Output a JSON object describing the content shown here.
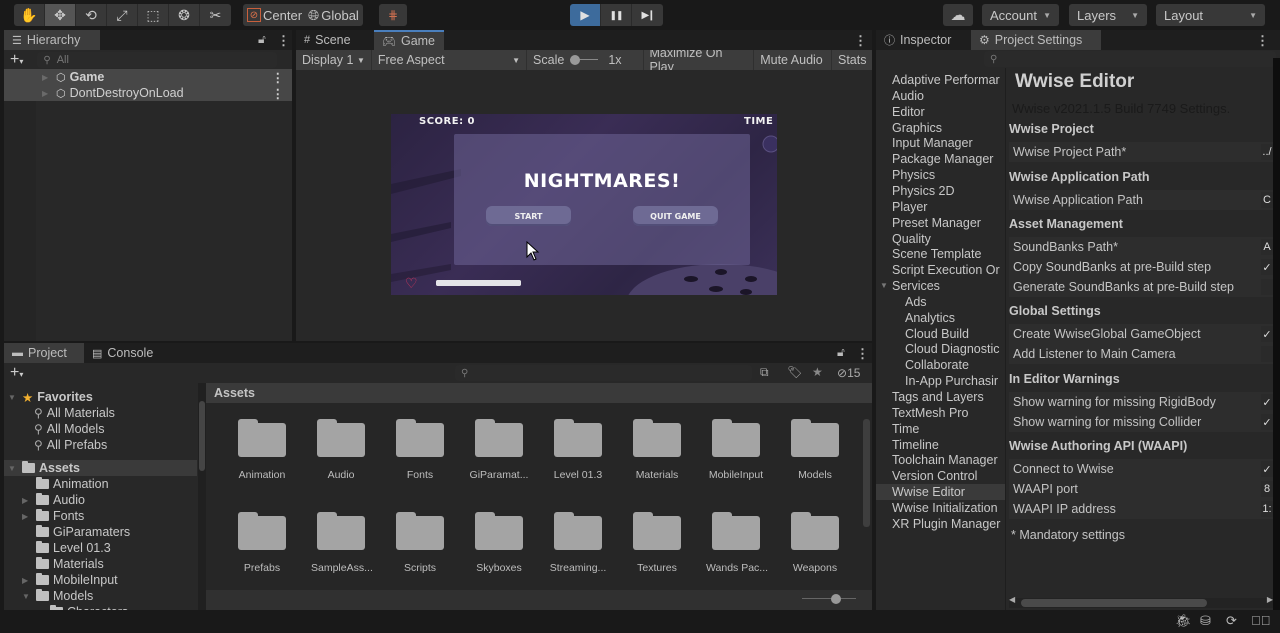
{
  "toolbar": {
    "tools": [
      {
        "name": "hand-tool",
        "glyph": "✋",
        "active": false
      },
      {
        "name": "move-tool",
        "glyph": "✥",
        "active": true
      },
      {
        "name": "rotate-tool",
        "glyph": "⟲",
        "active": false
      },
      {
        "name": "scale-tool",
        "glyph": "⤢",
        "active": false
      },
      {
        "name": "rect-tool",
        "glyph": "⬚",
        "active": false
      },
      {
        "name": "transform-tool",
        "glyph": "❂",
        "active": false
      },
      {
        "name": "custom-tool",
        "glyph": "✂",
        "active": false
      }
    ],
    "pivot_label": "Center",
    "rotation_label": "Global",
    "grid_snap_icon": "grid-snap-icon",
    "play_controls": {
      "play": "▶",
      "pause": "❚❚",
      "step": "▶❙"
    },
    "cloud_icon": "☁",
    "account_label": "Account",
    "layers_label": "Layers",
    "layout_label": "Layout"
  },
  "hierarchy": {
    "tab_label": "Hierarchy",
    "search_placeholder": "All",
    "items": [
      "Game",
      "DontDestroyOnLoad"
    ]
  },
  "game_view": {
    "tabs": [
      "Scene",
      "Game"
    ],
    "display": "Display 1",
    "aspect": "Free Aspect",
    "scale_label": "Scale",
    "scale_value": "1x",
    "maximize_label": "Maximize On Play",
    "mute_label": "Mute Audio",
    "stats_label": "Stats",
    "game": {
      "score": "SCORE: 0",
      "time": "TIME",
      "title": "NIGHTMARES!",
      "start_label": "START",
      "quit_label": "QUIT GAME",
      "health_fraction": 1.0
    }
  },
  "project": {
    "tabs": [
      "Project",
      "Console"
    ],
    "hidden_count": "15",
    "favorites_label": "Favorites",
    "favorites": [
      "All Materials",
      "All Models",
      "All Prefabs"
    ],
    "assets_label": "Assets",
    "tree": [
      {
        "label": "Animation",
        "expandable": false
      },
      {
        "label": "Audio",
        "expandable": true
      },
      {
        "label": "Fonts",
        "expandable": true
      },
      {
        "label": "GiParamaters",
        "expandable": false
      },
      {
        "label": "Level 01.3",
        "expandable": false
      },
      {
        "label": "Materials",
        "expandable": false
      },
      {
        "label": "MobileInput",
        "expandable": true
      },
      {
        "label": "Models",
        "expandable": true,
        "expanded": true
      },
      {
        "label": "Characters",
        "expandable": false
      }
    ],
    "breadcrumb": "Assets",
    "folders": [
      "Animation",
      "Audio",
      "Fonts",
      "GiParamat...",
      "Level 01.3",
      "Materials",
      "MobileInput",
      "Models",
      "Prefabs",
      "SampleAss...",
      "Scripts",
      "Skyboxes",
      "Streaming...",
      "Textures",
      "Wands Pac...",
      "Weapons"
    ]
  },
  "inspector": {
    "tabs": [
      "Inspector",
      "Project Settings"
    ],
    "categories": [
      {
        "label": "Adaptive Performar",
        "indent": 0
      },
      {
        "label": "Audio",
        "indent": 0
      },
      {
        "label": "Editor",
        "indent": 0
      },
      {
        "label": "Graphics",
        "indent": 0
      },
      {
        "label": "Input Manager",
        "indent": 0
      },
      {
        "label": "Package Manager",
        "indent": 0
      },
      {
        "label": "Physics",
        "indent": 0
      },
      {
        "label": "Physics 2D",
        "indent": 0
      },
      {
        "label": "Player",
        "indent": 0
      },
      {
        "label": "Preset Manager",
        "indent": 0
      },
      {
        "label": "Quality",
        "indent": 0
      },
      {
        "label": "Scene Template",
        "indent": 0
      },
      {
        "label": "Script Execution Or",
        "indent": 0
      },
      {
        "label": "Services",
        "indent": 0,
        "expanded": true
      },
      {
        "label": "Ads",
        "indent": 1
      },
      {
        "label": "Analytics",
        "indent": 1
      },
      {
        "label": "Cloud Build",
        "indent": 1
      },
      {
        "label": "Cloud Diagnostic",
        "indent": 1
      },
      {
        "label": "Collaborate",
        "indent": 1
      },
      {
        "label": "In-App Purchasir",
        "indent": 1
      },
      {
        "label": "Tags and Layers",
        "indent": 0
      },
      {
        "label": "TextMesh Pro",
        "indent": 0
      },
      {
        "label": "Time",
        "indent": 0
      },
      {
        "label": "Timeline",
        "indent": 0
      },
      {
        "label": "Toolchain Manager",
        "indent": 0
      },
      {
        "label": "Version Control",
        "indent": 0
      },
      {
        "label": "Wwise Editor",
        "indent": 0,
        "selected": true
      },
      {
        "label": "Wwise Initialization",
        "indent": 0
      },
      {
        "label": "XR Plugin Manager",
        "indent": 0
      }
    ],
    "settings": {
      "title": "Wwise Editor",
      "subtitle": "Wwise v2021.1.5 Build 7749 Settings.",
      "sections": [
        {
          "header": "Wwise Project",
          "rows": [
            {
              "label": "Wwise Project Path*",
              "value": "../"
            }
          ]
        },
        {
          "header": "Wwise Application Path",
          "rows": [
            {
              "label": "Wwise Application Path",
              "value": "C"
            }
          ]
        },
        {
          "header": "Asset Management",
          "rows": [
            {
              "label": "SoundBanks Path*",
              "value": "A"
            },
            {
              "label": "Copy SoundBanks at pre-Build step",
              "value": "✓"
            },
            {
              "label": "Generate SoundBanks at pre-Build step",
              "value": ""
            }
          ]
        },
        {
          "header": "Global Settings",
          "rows": [
            {
              "label": "Create WwiseGlobal GameObject",
              "value": "✓"
            },
            {
              "label": "Add Listener to Main Camera",
              "value": ""
            }
          ]
        },
        {
          "header": "In Editor Warnings",
          "rows": [
            {
              "label": "Show warning for missing RigidBody",
              "value": "✓"
            },
            {
              "label": "Show warning for missing Collider",
              "value": "✓"
            }
          ]
        },
        {
          "header": "Wwise Authoring API (WAAPI)",
          "rows": [
            {
              "label": "Connect to Wwise",
              "value": "✓"
            },
            {
              "label": "WAAPI port",
              "value": "8"
            },
            {
              "label": "WAAPI IP address",
              "value": "1:"
            }
          ]
        }
      ],
      "footnote": "* Mandatory settings"
    }
  },
  "colors": {
    "accent": "#3d6b9c",
    "tab_highlight": "#4a7fbd",
    "heart": "#e0385e"
  }
}
